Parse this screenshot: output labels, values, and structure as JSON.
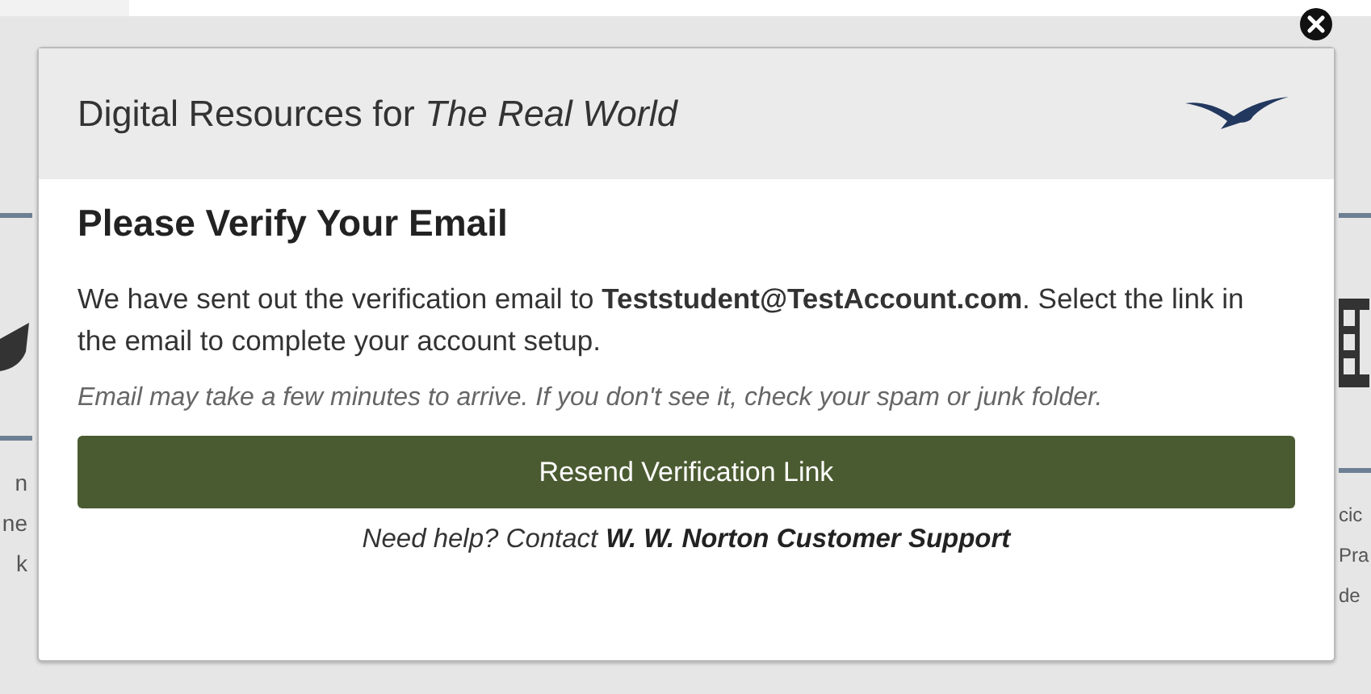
{
  "background": {
    "left_fragments": [
      "n",
      "ne",
      "k"
    ],
    "right_fragments": [
      "cic",
      "Pra",
      "de"
    ]
  },
  "dialog": {
    "title": "Digital Resources for *The Real World*",
    "heading": "Please Verify Your Email",
    "message": "We have sent out the verification email to **Teststudent@TestAccount.com**. Select the link in the email to complete your account setup.",
    "note": "Email may take a few minutes to arrive. If you don't see it, check your spam or junk folder.",
    "button": "Resend Verification Link",
    "help": {
      "text": "Need help? Contact",
      "link": "W. W. Norton Customer Support"
    }
  }
}
